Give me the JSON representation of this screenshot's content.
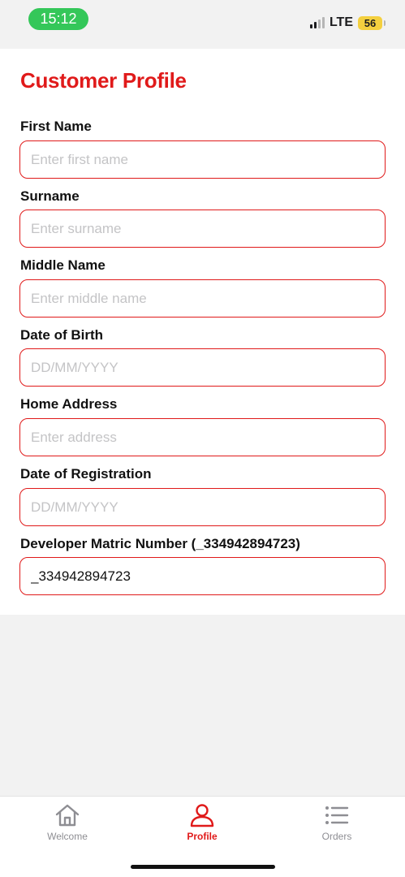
{
  "status_bar": {
    "time": "15:12",
    "network": "LTE",
    "battery": "56"
  },
  "form": {
    "title": "Customer Profile",
    "fields": [
      {
        "label": "First Name",
        "placeholder": "Enter first name",
        "value": ""
      },
      {
        "label": "Surname",
        "placeholder": "Enter surname",
        "value": ""
      },
      {
        "label": "Middle Name",
        "placeholder": "Enter middle name",
        "value": ""
      },
      {
        "label": "Date of Birth",
        "placeholder": "DD/MM/YYYY",
        "value": ""
      },
      {
        "label": "Home Address",
        "placeholder": "Enter address",
        "value": ""
      },
      {
        "label": "Date of Registration",
        "placeholder": "DD/MM/YYYY",
        "value": ""
      },
      {
        "label": "Developer Matric Number (_334942894723)",
        "placeholder": "",
        "value": "_334942894723"
      }
    ]
  },
  "tabs": [
    {
      "label": "Welcome",
      "icon": "house-icon",
      "active": false
    },
    {
      "label": "Profile",
      "icon": "person-icon",
      "active": true
    },
    {
      "label": "Orders",
      "icon": "list-icon",
      "active": false
    }
  ],
  "colors": {
    "accent": "#e01a1a",
    "status_pill": "#34c759",
    "battery": "#f4d03f",
    "inactive": "#8e8e93"
  }
}
